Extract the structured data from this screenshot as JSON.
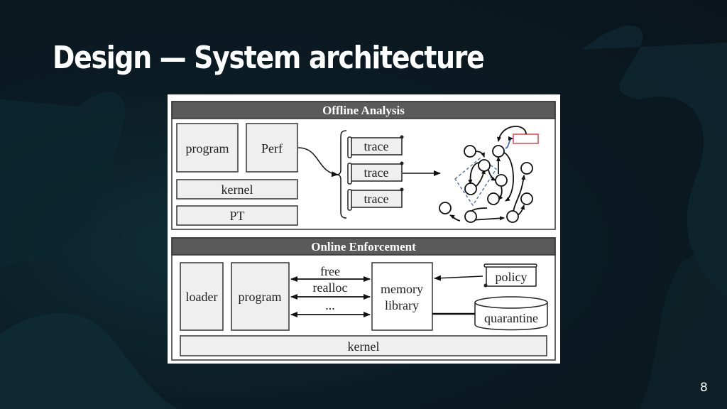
{
  "slide": {
    "title": "Design — System architecture",
    "page_number": "8"
  },
  "diagram": {
    "offline_section": {
      "header": "Offline Analysis",
      "boxes": {
        "program": "program",
        "perf": "Perf",
        "kernel": "kernel",
        "pt": "PT"
      },
      "traces": [
        "trace",
        "trace",
        "trace"
      ]
    },
    "online_section": {
      "header": "Online Enforcement",
      "boxes": {
        "loader": "loader",
        "program": "program",
        "memory_library_line1": "memory",
        "memory_library_line2": "library",
        "kernel": "kernel"
      },
      "calls": [
        "free",
        "realloc",
        "..."
      ],
      "policy": "policy",
      "quarantine": "quarantine"
    },
    "colors": {
      "header_bg": "#5a5a5a",
      "box_fill": "#efefef",
      "highlight_box": "#e8505b",
      "dashed_region": "#4a6fb5",
      "blue_edge": "#3a6cc4"
    }
  }
}
